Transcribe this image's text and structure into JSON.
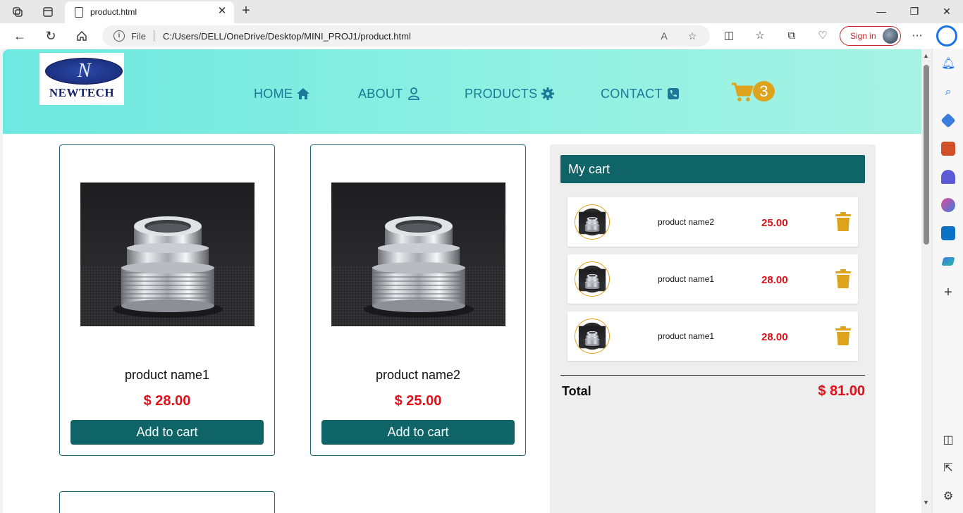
{
  "browser": {
    "tab_title": "product.html",
    "url_scheme": "File",
    "url": "C:/Users/DELL/OneDrive/Desktop/MINI_PROJ1/product.html",
    "signin_label": "Sign in"
  },
  "site": {
    "logo_mark": "N",
    "logo_text": "NEWTECH",
    "nav": [
      {
        "label": "HOME",
        "icon": "home-icon"
      },
      {
        "label": "ABOUT",
        "icon": "user-icon"
      },
      {
        "label": "PRODUCTS",
        "icon": "gear-icon"
      },
      {
        "label": "CONTACT",
        "icon": "phone-icon"
      }
    ],
    "cart_count": "3",
    "accent_color": "#0e6466",
    "price_color": "#e0101a",
    "badge_color": "#dea31d"
  },
  "products": [
    {
      "name": "product name1",
      "price": "$ 28.00",
      "button": "Add to cart"
    },
    {
      "name": "product name2",
      "price": "$ 25.00",
      "button": "Add to cart"
    }
  ],
  "cart": {
    "title": "My cart",
    "items": [
      {
        "name": "product name2",
        "price": "25.00"
      },
      {
        "name": "product name1",
        "price": "28.00"
      },
      {
        "name": "product name1",
        "price": "28.00"
      }
    ],
    "total_label": "Total",
    "total_value": "$ 81.00"
  }
}
